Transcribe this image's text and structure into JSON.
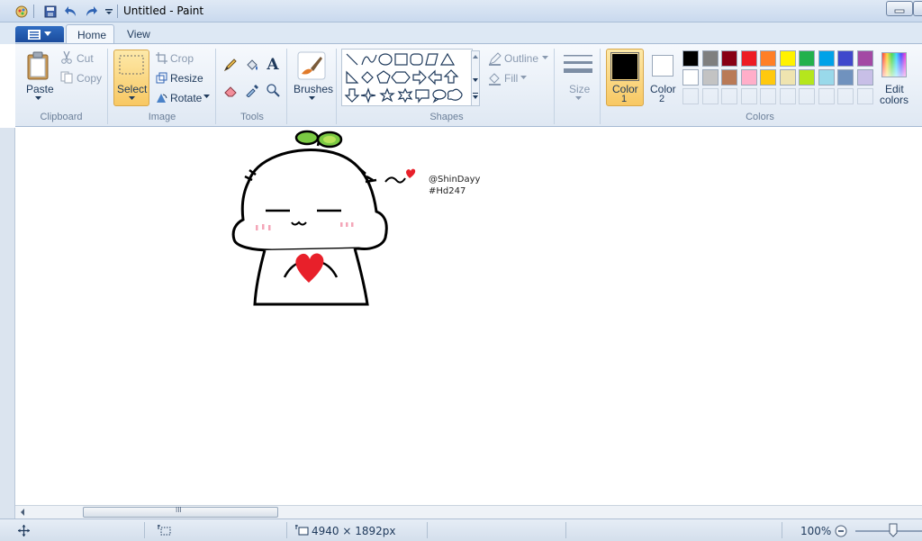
{
  "window": {
    "title": "Untitled - Paint"
  },
  "tabs": [
    {
      "label": "Home",
      "active": true
    },
    {
      "label": "View",
      "active": false
    }
  ],
  "clipboard": {
    "paste": "Paste",
    "cut": "Cut",
    "copy": "Copy",
    "group": "Clipboard"
  },
  "image": {
    "select": "Select",
    "crop": "Crop",
    "resize": "Resize",
    "rotate": "Rotate",
    "group": "Image"
  },
  "tools": {
    "group": "Tools"
  },
  "brushes": {
    "label": "Brushes"
  },
  "shapes": {
    "outline": "Outline",
    "fill": "Fill",
    "group": "Shapes"
  },
  "size": {
    "label": "Size"
  },
  "colors": {
    "color1_label": "Color",
    "color1_num": "1",
    "color2_label": "Color",
    "color2_num": "2",
    "edit_label": "Edit",
    "edit_label2": "colors",
    "group": "Colors",
    "color1_value": "#000000",
    "color2_value": "#ffffff",
    "palette_row1": [
      "#000000",
      "#7f7f7f",
      "#880015",
      "#ed1c24",
      "#ff7f27",
      "#fff200",
      "#22b14c",
      "#00a2e8",
      "#3f48cc",
      "#a349a4"
    ],
    "palette_row2": [
      "#ffffff",
      "#c3c3c3",
      "#b97a57",
      "#ffaec9",
      "#ffc90e",
      "#efe4b0",
      "#b5e61d",
      "#99d9ea",
      "#7092be",
      "#c8bfe7"
    ],
    "palette_row3": [
      "",
      "",
      "",
      "",
      "",
      "",
      "",
      "",
      "",
      ""
    ]
  },
  "artwork": {
    "handle": "@ShinDayy",
    "tag": "#Hd247",
    "sprout_color": "#7ac943",
    "heart_color": "#e8202a",
    "blush_color": "#f4a6b8"
  },
  "status": {
    "dimensions": "4940 × 1892px",
    "zoom": "100%",
    "scroll_mid": "III"
  }
}
